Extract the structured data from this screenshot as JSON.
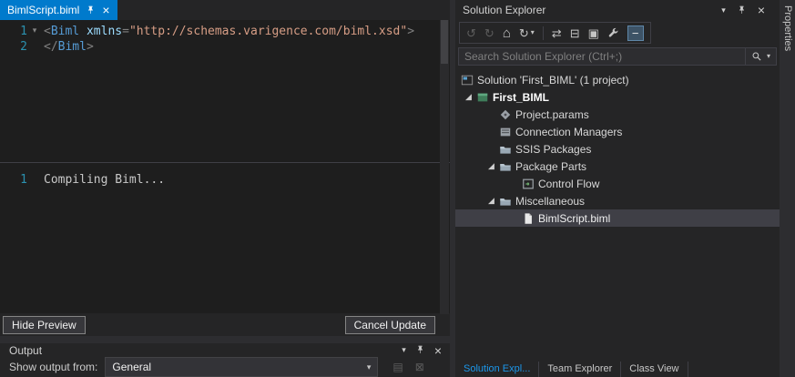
{
  "colors": {
    "accent": "#007acc",
    "selection": "#3f3f46",
    "editor_bg": "#1e1e1e",
    "panel_bg": "#252526"
  },
  "icons": {
    "chevron_down": "▾",
    "close": "×",
    "back": "↺",
    "forward": "↻",
    "home": "⌂",
    "refresh": "↻",
    "sync": "⇄",
    "collapse_all": "⊟",
    "show_all_files": "▣",
    "preview_toggle": "−",
    "expander_open": "◢",
    "fold_open": "▾",
    "output_icon_a": "▤",
    "output_icon_b": "⊠"
  },
  "editor": {
    "tab_title": "BimlScript.biml",
    "code_lines": [
      {
        "num": "1",
        "fold": "open",
        "tokens": [
          {
            "text": "<",
            "type": "punct"
          },
          {
            "text": "Biml",
            "type": "tag"
          },
          {
            "text": " ",
            "type": "plain"
          },
          {
            "text": "xmlns",
            "type": "attr"
          },
          {
            "text": "=",
            "type": "punct"
          },
          {
            "text": "\"http://schemas.varigence.com/biml.xsd\"",
            "type": "string"
          },
          {
            "text": ">",
            "type": "punct"
          }
        ]
      },
      {
        "num": "2",
        "fold": "none",
        "tokens": [
          {
            "text": "</",
            "type": "punct"
          },
          {
            "text": "Biml",
            "type": "tag"
          },
          {
            "text": ">",
            "type": "punct"
          }
        ]
      }
    ],
    "preview": {
      "lines": [
        {
          "num": "1",
          "text": "Compiling Biml..."
        }
      ],
      "hide_button_label": "Hide Preview",
      "cancel_button_label": "Cancel Update"
    }
  },
  "output_panel": {
    "title": "Output",
    "show_from_label": "Show output from:",
    "selected_source": "General"
  },
  "solution_explorer": {
    "title": "Solution Explorer",
    "search_placeholder": "Search Solution Explorer (Ctrl+;)",
    "tree": [
      {
        "label": "Solution 'First_BIML' (1 project)",
        "icon": "solution",
        "indent": 0,
        "expander": "none",
        "slot": false
      },
      {
        "label": "First_BIML",
        "icon": "project",
        "indent": 0,
        "expander": "open",
        "bold": true
      },
      {
        "label": "Project.params",
        "icon": "params",
        "indent": 1,
        "expander": "blank"
      },
      {
        "label": "Connection Managers",
        "icon": "connection",
        "indent": 1,
        "expander": "blank"
      },
      {
        "label": "SSIS Packages",
        "icon": "folder",
        "indent": 1,
        "expander": "blank"
      },
      {
        "label": "Package Parts",
        "icon": "folder",
        "indent": 1,
        "expander": "open"
      },
      {
        "label": "Control Flow",
        "icon": "control-flow",
        "indent": 2,
        "expander": "blank"
      },
      {
        "label": "Miscellaneous",
        "icon": "folder",
        "indent": 1,
        "expander": "open"
      },
      {
        "label": "BimlScript.biml",
        "icon": "file",
        "indent": 2,
        "expander": "blank",
        "selected": true
      }
    ],
    "bottom_tabs": [
      {
        "label": "Solution Expl...",
        "active": true
      },
      {
        "label": "Team Explorer",
        "active": false
      },
      {
        "label": "Class View",
        "active": false
      }
    ]
  },
  "right_edge": {
    "tab_label": "Properties"
  }
}
